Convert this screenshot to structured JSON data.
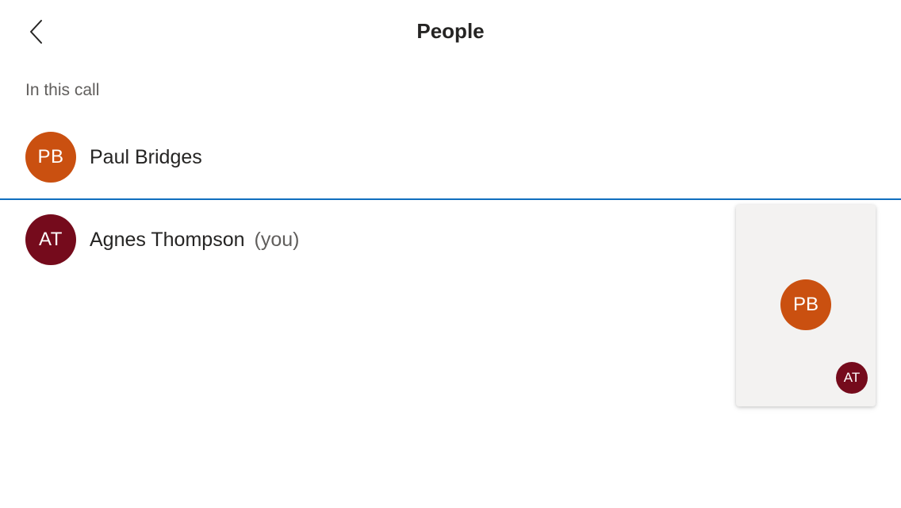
{
  "header": {
    "title": "People",
    "back_icon": "chevron-left-icon"
  },
  "section": {
    "label": "In this call"
  },
  "participants": [
    {
      "initials": "PB",
      "name": "Paul Bridges",
      "suffix": "",
      "color": "#ca5010"
    },
    {
      "initials": "AT",
      "name": "Agnes Thompson",
      "suffix": "(you)",
      "color": "#750b1c"
    }
  ],
  "video_tile": {
    "main_initials": "PB",
    "main_color": "#ca5010",
    "self_initials": "AT",
    "self_color": "#750b1c"
  },
  "colors": {
    "accent": "#106ebe",
    "tile_background": "#f3f2f1"
  }
}
